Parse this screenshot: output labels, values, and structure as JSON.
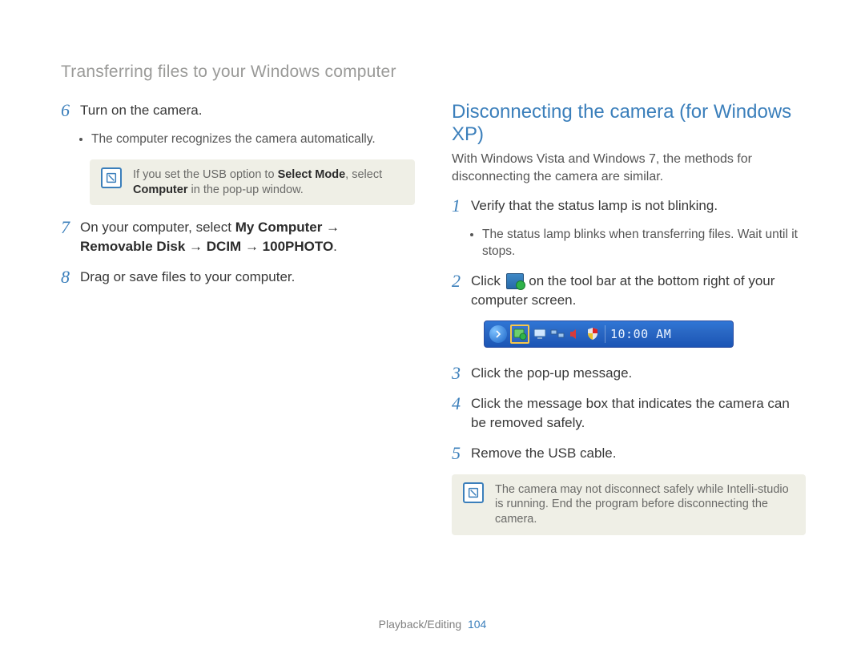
{
  "header": {
    "title": "Transferring files to your Windows computer"
  },
  "left": {
    "steps": {
      "s6": {
        "num": "6",
        "text": "Turn on the camera."
      },
      "s6_sub": {
        "a": "The computer recognizes the camera automatically."
      },
      "note6": {
        "pre": "If you set the USB option to ",
        "b1": "Select Mode",
        "mid": ", select ",
        "b2": "Computer",
        "post": " in the pop-up window."
      },
      "s7": {
        "num": "7",
        "pre": "On your computer, select ",
        "path": "My Computer → Removable Disk → DCIM → 100PHOTO",
        "post": "."
      },
      "s8": {
        "num": "8",
        "text": "Drag or save files to your computer."
      }
    }
  },
  "right": {
    "heading": "Disconnecting the camera (for Windows XP)",
    "intro": "With Windows Vista and Windows 7, the methods for disconnecting the camera are similar.",
    "steps": {
      "s1": {
        "num": "1",
        "text": "Verify that the status lamp is not blinking."
      },
      "s1_sub": {
        "a": "The status lamp blinks when transferring files. Wait until it stops."
      },
      "s2": {
        "num": "2",
        "pre": "Click ",
        "post": " on the tool bar at the bottom right of your computer screen."
      },
      "taskbar": {
        "clock": "10:00 AM"
      },
      "s3": {
        "num": "3",
        "text": "Click the pop-up message."
      },
      "s4": {
        "num": "4",
        "text": "Click the message box that indicates the camera can be removed safely."
      },
      "s5": {
        "num": "5",
        "text": "Remove the USB cable."
      },
      "note5": {
        "text": "The camera may not disconnect safely while Intelli-studio is running. End the program before disconnecting the camera."
      }
    }
  },
  "footer": {
    "section": "Playback/Editing",
    "page": "104"
  }
}
